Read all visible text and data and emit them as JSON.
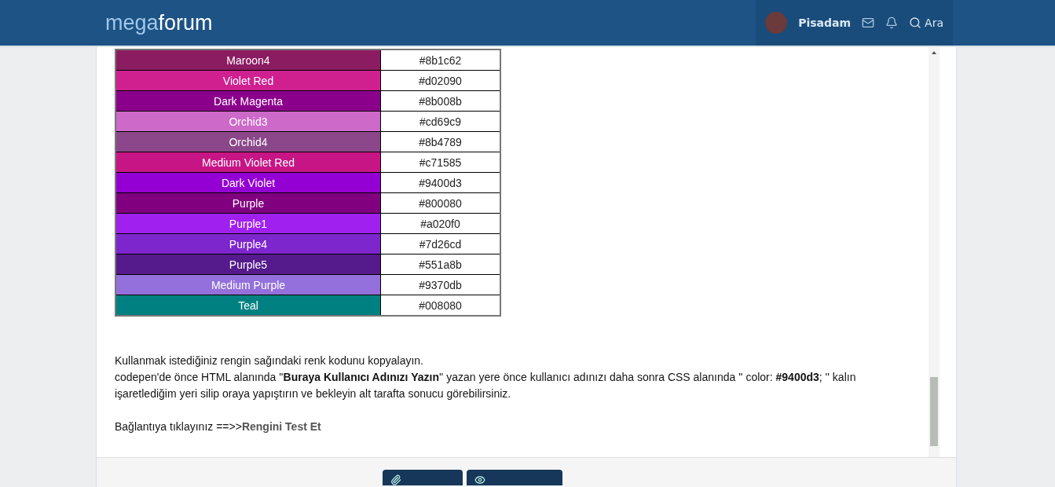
{
  "header": {
    "logo_light": "mega",
    "logo_bold": "forum",
    "user": "Pisadam",
    "search": "Ara"
  },
  "color_table": [
    {
      "name": "Maroon4",
      "code": "#8b1c62",
      "color": "#8b1c62"
    },
    {
      "name": "Violet Red",
      "code": "#d02090",
      "color": "#d02090"
    },
    {
      "name": "Dark Magenta",
      "code": "#8b008b",
      "color": "#8b008b"
    },
    {
      "name": "Orchid3",
      "code": "#cd69c9",
      "color": "#cd69c9"
    },
    {
      "name": "Orchid4",
      "code": "#8b4789",
      "color": "#8b4789"
    },
    {
      "name": "Medium Violet Red",
      "code": "#c71585",
      "color": "#c71585"
    },
    {
      "name": "Dark Violet",
      "code": "#9400d3",
      "color": "#9400d3"
    },
    {
      "name": "Purple",
      "code": "#800080",
      "color": "#800080"
    },
    {
      "name": "Purple1",
      "code": "#a020f0",
      "color": "#a020f0"
    },
    {
      "name": "Purple4",
      "code": "#7d26cd",
      "color": "#7d26cd"
    },
    {
      "name": "Purple5",
      "code": "#551a8b",
      "color": "#551a8b"
    },
    {
      "name": "Medium Purple",
      "code": "#9370db",
      "color": "#9370db"
    },
    {
      "name": "Teal",
      "code": "#008080",
      "color": "#008080"
    }
  ],
  "paragraphs": [
    "Kullanmak istediğiniz rengin sağındaki renk kodunu kopyalayın.",
    "codepen'de önce HTML alanında ''**Buraya Kullanıcı Adınızı Yazın**'' yazan yere önce kullanıcı adınızı daha sonra CSS alanında '' color: **#9400d3**; '' kalın işaretlediğim yeri silip oraya yapıştırın ve bekleyin alt tarafta sonucu görebilirsiniz."
  ],
  "link_line": {
    "prefix": "Bağlantıya tıklayınız ==>>",
    "link": "Rengini Test Et"
  }
}
